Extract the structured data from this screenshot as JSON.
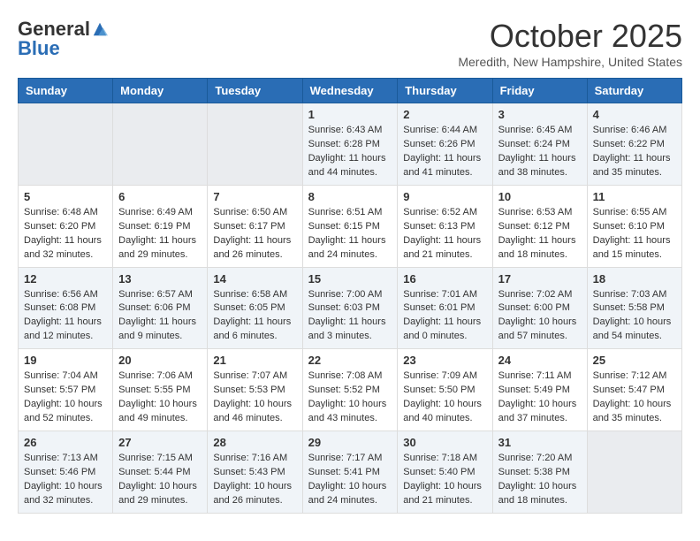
{
  "header": {
    "logo_general": "General",
    "logo_blue": "Blue",
    "month_year": "October 2025",
    "location": "Meredith, New Hampshire, United States"
  },
  "days_of_week": [
    "Sunday",
    "Monday",
    "Tuesday",
    "Wednesday",
    "Thursday",
    "Friday",
    "Saturday"
  ],
  "weeks": [
    [
      {
        "day": "",
        "content": ""
      },
      {
        "day": "",
        "content": ""
      },
      {
        "day": "",
        "content": ""
      },
      {
        "day": "1",
        "content": "Sunrise: 6:43 AM\nSunset: 6:28 PM\nDaylight: 11 hours and 44 minutes."
      },
      {
        "day": "2",
        "content": "Sunrise: 6:44 AM\nSunset: 6:26 PM\nDaylight: 11 hours and 41 minutes."
      },
      {
        "day": "3",
        "content": "Sunrise: 6:45 AM\nSunset: 6:24 PM\nDaylight: 11 hours and 38 minutes."
      },
      {
        "day": "4",
        "content": "Sunrise: 6:46 AM\nSunset: 6:22 PM\nDaylight: 11 hours and 35 minutes."
      }
    ],
    [
      {
        "day": "5",
        "content": "Sunrise: 6:48 AM\nSunset: 6:20 PM\nDaylight: 11 hours and 32 minutes."
      },
      {
        "day": "6",
        "content": "Sunrise: 6:49 AM\nSunset: 6:19 PM\nDaylight: 11 hours and 29 minutes."
      },
      {
        "day": "7",
        "content": "Sunrise: 6:50 AM\nSunset: 6:17 PM\nDaylight: 11 hours and 26 minutes."
      },
      {
        "day": "8",
        "content": "Sunrise: 6:51 AM\nSunset: 6:15 PM\nDaylight: 11 hours and 24 minutes."
      },
      {
        "day": "9",
        "content": "Sunrise: 6:52 AM\nSunset: 6:13 PM\nDaylight: 11 hours and 21 minutes."
      },
      {
        "day": "10",
        "content": "Sunrise: 6:53 AM\nSunset: 6:12 PM\nDaylight: 11 hours and 18 minutes."
      },
      {
        "day": "11",
        "content": "Sunrise: 6:55 AM\nSunset: 6:10 PM\nDaylight: 11 hours and 15 minutes."
      }
    ],
    [
      {
        "day": "12",
        "content": "Sunrise: 6:56 AM\nSunset: 6:08 PM\nDaylight: 11 hours and 12 minutes."
      },
      {
        "day": "13",
        "content": "Sunrise: 6:57 AM\nSunset: 6:06 PM\nDaylight: 11 hours and 9 minutes."
      },
      {
        "day": "14",
        "content": "Sunrise: 6:58 AM\nSunset: 6:05 PM\nDaylight: 11 hours and 6 minutes."
      },
      {
        "day": "15",
        "content": "Sunrise: 7:00 AM\nSunset: 6:03 PM\nDaylight: 11 hours and 3 minutes."
      },
      {
        "day": "16",
        "content": "Sunrise: 7:01 AM\nSunset: 6:01 PM\nDaylight: 11 hours and 0 minutes."
      },
      {
        "day": "17",
        "content": "Sunrise: 7:02 AM\nSunset: 6:00 PM\nDaylight: 10 hours and 57 minutes."
      },
      {
        "day": "18",
        "content": "Sunrise: 7:03 AM\nSunset: 5:58 PM\nDaylight: 10 hours and 54 minutes."
      }
    ],
    [
      {
        "day": "19",
        "content": "Sunrise: 7:04 AM\nSunset: 5:57 PM\nDaylight: 10 hours and 52 minutes."
      },
      {
        "day": "20",
        "content": "Sunrise: 7:06 AM\nSunset: 5:55 PM\nDaylight: 10 hours and 49 minutes."
      },
      {
        "day": "21",
        "content": "Sunrise: 7:07 AM\nSunset: 5:53 PM\nDaylight: 10 hours and 46 minutes."
      },
      {
        "day": "22",
        "content": "Sunrise: 7:08 AM\nSunset: 5:52 PM\nDaylight: 10 hours and 43 minutes."
      },
      {
        "day": "23",
        "content": "Sunrise: 7:09 AM\nSunset: 5:50 PM\nDaylight: 10 hours and 40 minutes."
      },
      {
        "day": "24",
        "content": "Sunrise: 7:11 AM\nSunset: 5:49 PM\nDaylight: 10 hours and 37 minutes."
      },
      {
        "day": "25",
        "content": "Sunrise: 7:12 AM\nSunset: 5:47 PM\nDaylight: 10 hours and 35 minutes."
      }
    ],
    [
      {
        "day": "26",
        "content": "Sunrise: 7:13 AM\nSunset: 5:46 PM\nDaylight: 10 hours and 32 minutes."
      },
      {
        "day": "27",
        "content": "Sunrise: 7:15 AM\nSunset: 5:44 PM\nDaylight: 10 hours and 29 minutes."
      },
      {
        "day": "28",
        "content": "Sunrise: 7:16 AM\nSunset: 5:43 PM\nDaylight: 10 hours and 26 minutes."
      },
      {
        "day": "29",
        "content": "Sunrise: 7:17 AM\nSunset: 5:41 PM\nDaylight: 10 hours and 24 minutes."
      },
      {
        "day": "30",
        "content": "Sunrise: 7:18 AM\nSunset: 5:40 PM\nDaylight: 10 hours and 21 minutes."
      },
      {
        "day": "31",
        "content": "Sunrise: 7:20 AM\nSunset: 5:38 PM\nDaylight: 10 hours and 18 minutes."
      },
      {
        "day": "",
        "content": ""
      }
    ]
  ]
}
